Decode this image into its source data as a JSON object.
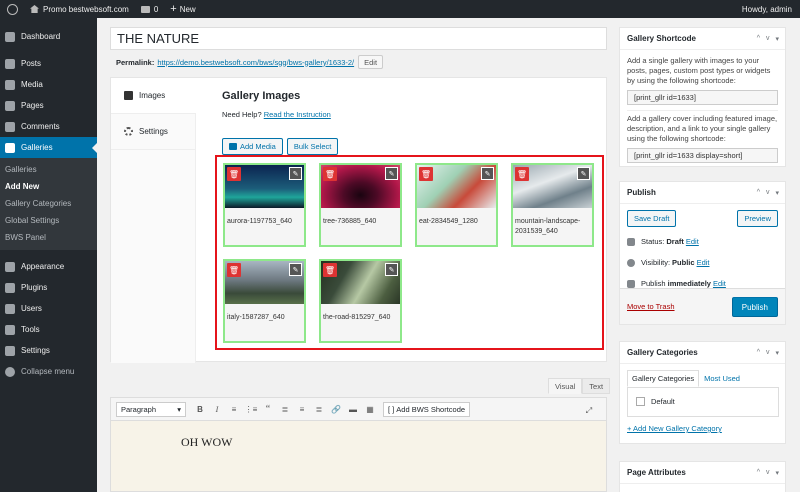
{
  "admin_bar": {
    "site_name": "Promo bestwebsoft.com",
    "comments_count": "0",
    "new_label": "New",
    "howdy": "Howdy, admin"
  },
  "sidebar": {
    "items": [
      {
        "label": "Dashboard",
        "icon": "dashboard-icon"
      },
      {
        "label": "Posts",
        "icon": "pin-icon"
      },
      {
        "label": "Media",
        "icon": "media-icon"
      },
      {
        "label": "Pages",
        "icon": "page-icon"
      },
      {
        "label": "Comments",
        "icon": "comment-icon"
      },
      {
        "label": "Galleries",
        "icon": "gallery-icon"
      },
      {
        "label": "Appearance",
        "icon": "brush-icon"
      },
      {
        "label": "Plugins",
        "icon": "plug-icon"
      },
      {
        "label": "Users",
        "icon": "user-icon"
      },
      {
        "label": "Tools",
        "icon": "wrench-icon"
      },
      {
        "label": "Settings",
        "icon": "sliders-icon"
      },
      {
        "label": "Collapse menu",
        "icon": "collapse-icon"
      }
    ],
    "submenu": [
      "Galleries",
      "Add New",
      "Gallery Categories",
      "Global Settings",
      "BWS Panel"
    ]
  },
  "post": {
    "title": "THE NATURE",
    "permalink_label": "Permalink:",
    "permalink_url": "https://demo.bestwebsoft.com/bws/sgg/bws-gallery/1633-2/",
    "edit_label": "Edit"
  },
  "gallery": {
    "tabs": [
      "Images",
      "Settings"
    ],
    "heading": "Gallery Images",
    "need_help": "Need Help?",
    "instruction_link": "Read the Instruction",
    "add_media": "Add Media",
    "bulk_select": "Bulk Select",
    "images": [
      {
        "caption": "aurora-1197753_640",
        "colors": [
          "#0b2450",
          "#1fa59a"
        ]
      },
      {
        "caption": "tree-736885_640",
        "colors": [
          "#b3184a",
          "#2a0920"
        ]
      },
      {
        "caption": "eat-2834549_1280",
        "colors": [
          "#d9ece6",
          "#c84a3a"
        ]
      },
      {
        "caption": "mountain-landscape-2031539_640",
        "colors": [
          "#7e8f98",
          "#e6eaec"
        ]
      },
      {
        "caption": "italy-1587287_640",
        "colors": [
          "#8f9aa4",
          "#3a4a3a"
        ]
      },
      {
        "caption": "the-road-815297_640",
        "colors": [
          "#3a4b3a",
          "#8fa57c"
        ]
      }
    ]
  },
  "editor": {
    "tabs": [
      "Visual",
      "Text"
    ],
    "format": "Paragraph",
    "bws_shortcode": "Add BWS Shortcode",
    "content": "OH WOW"
  },
  "shortcode_box": {
    "title": "Gallery Shortcode",
    "text1": "Add a single gallery with images to your posts, pages, custom post types or widgets by using the following shortcode:",
    "code1": "[print_gllr id=1633]",
    "text2": "Add a gallery cover including featured image, description, and a link to your single gallery using the following shortcode:",
    "code2": "[print_gllr id=1633 display=short]"
  },
  "publish_box": {
    "title": "Publish",
    "save_draft": "Save Draft",
    "preview": "Preview",
    "status_label": "Status:",
    "status_value": "Draft",
    "visibility_label": "Visibility:",
    "visibility_value": "Public",
    "publish_label": "Publish",
    "publish_value": "immediately",
    "edit": "Edit",
    "trash": "Move to Trash",
    "publish_button": "Publish"
  },
  "categories_box": {
    "title": "Gallery Categories",
    "tab_all": "Gallery Categories",
    "tab_used": "Most Used",
    "default": "Default",
    "add_new": "+ Add New Gallery Category"
  },
  "attributes_box": {
    "title": "Page Attributes"
  },
  "box_controls": [
    "^",
    "v",
    "▾"
  ]
}
